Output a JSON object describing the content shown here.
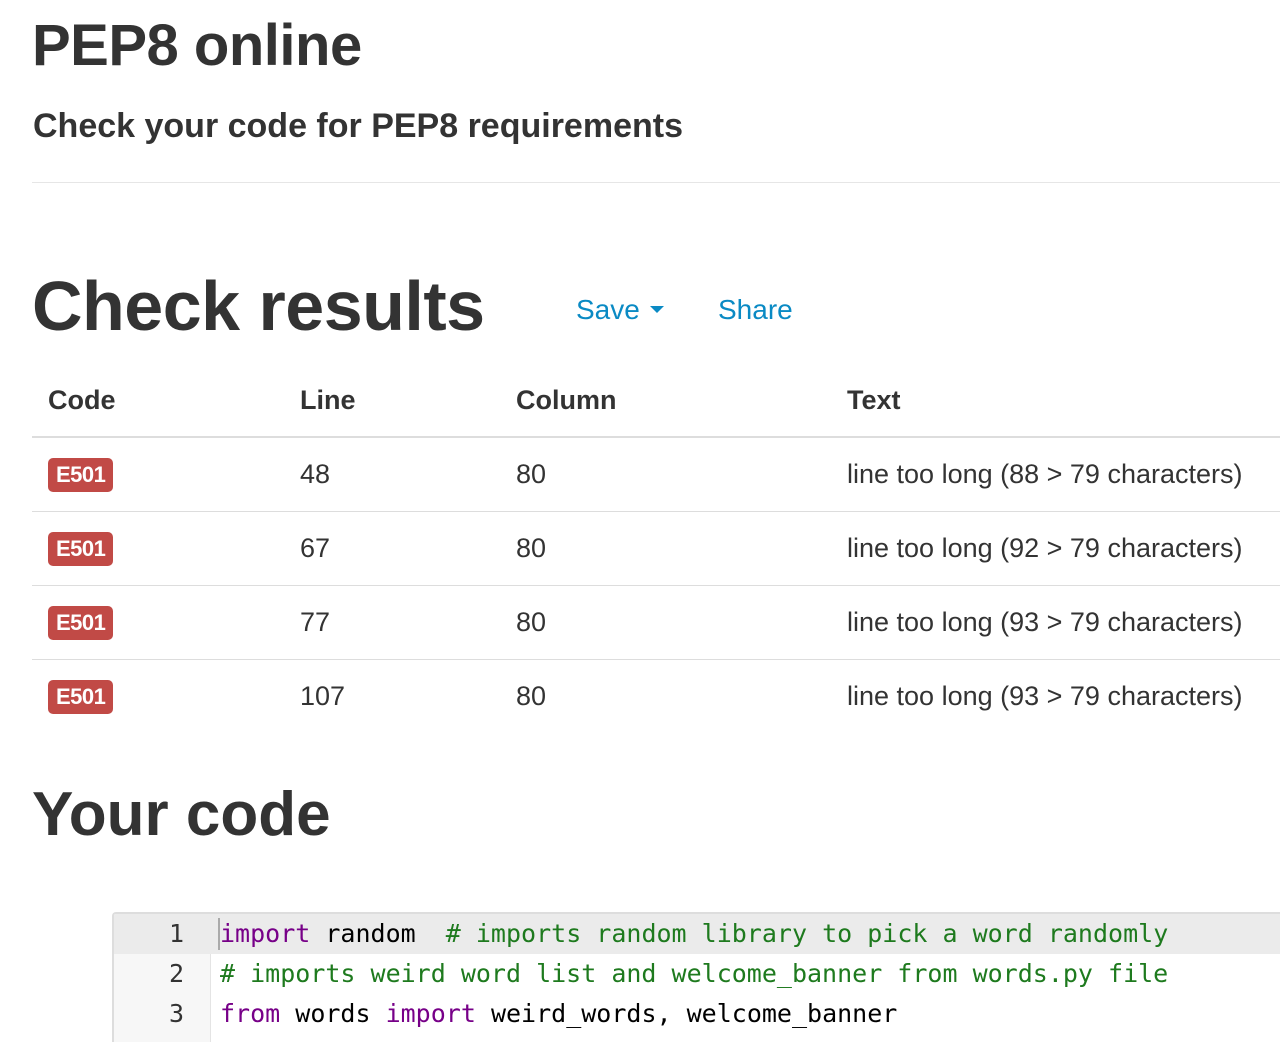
{
  "header": {
    "title": "PEP8 online",
    "subtitle": "Check your code for PEP8 requirements"
  },
  "results": {
    "title": "Check results",
    "save_label": "Save",
    "share_label": "Share",
    "columns": [
      "Code",
      "Line",
      "Column",
      "Text"
    ],
    "rows": [
      {
        "code": "E501",
        "line": "48",
        "column": "80",
        "text": "line too long (88 > 79 characters)"
      },
      {
        "code": "E501",
        "line": "67",
        "column": "80",
        "text": "line too long (92 > 79 characters)"
      },
      {
        "code": "E501",
        "line": "77",
        "column": "80",
        "text": "line too long (93 > 79 characters)"
      },
      {
        "code": "E501",
        "line": "107",
        "column": "80",
        "text": "line too long (93 > 79 characters)"
      }
    ],
    "badge_color": "#c14a46"
  },
  "code": {
    "title": "Your code",
    "lines": [
      {
        "number": "1",
        "tokens": [
          {
            "type": "kw",
            "text": "import"
          },
          {
            "type": "plain",
            "text": " random  "
          },
          {
            "type": "cm",
            "text": "# imports random library to pick a word randomly"
          }
        ]
      },
      {
        "number": "2",
        "tokens": [
          {
            "type": "cm",
            "text": "# imports weird word list and welcome_banner from words.py file"
          }
        ]
      },
      {
        "number": "3",
        "tokens": [
          {
            "type": "kw",
            "text": "from"
          },
          {
            "type": "plain",
            "text": " words "
          },
          {
            "type": "kw",
            "text": "import"
          },
          {
            "type": "plain",
            "text": " weird_words, welcome_banner"
          }
        ]
      }
    ]
  },
  "colors": {
    "link": "#0a8ac4",
    "keyword": "#770088",
    "comment": "#1e7a1e"
  }
}
